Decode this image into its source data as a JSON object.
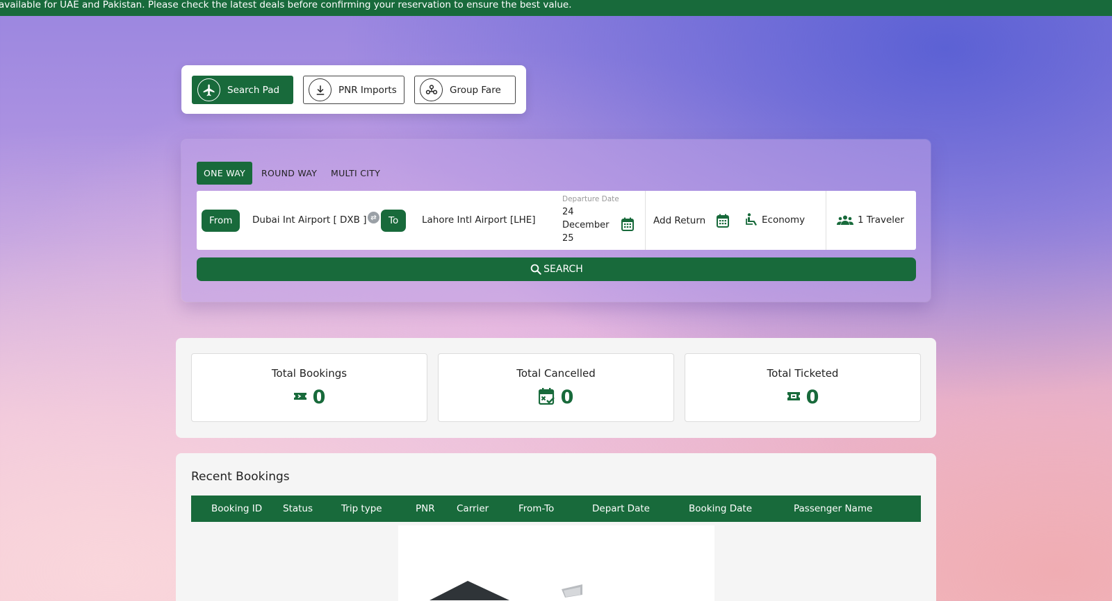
{
  "banner": {
    "text": "available for UAE and Pakistan. Please check the latest deals before confirming your reservation to ensure the best value."
  },
  "toolpad": {
    "buttons": [
      {
        "label": "Search Pad",
        "icon": "airplane-icon",
        "active": true
      },
      {
        "label": "PNR Imports",
        "icon": "download-icon",
        "active": false
      },
      {
        "label": "Group Fare",
        "icon": "group-icon",
        "active": false
      }
    ]
  },
  "search": {
    "trip_tabs": [
      "ONE WAY",
      "ROUND WAY",
      "MULTI CITY"
    ],
    "active_tab": "ONE WAY",
    "from_label": "From",
    "from_value": "Dubai Int Airport [ DXB ]",
    "to_label": "To",
    "to_value": "Lahore Intl Airport [LHE]",
    "departure_label": "Departure Date",
    "departure_value": "24 December 25",
    "add_return": "Add Return",
    "cabin_class": "Economy",
    "travelers": "1 Traveler",
    "search_button": "SEARCH"
  },
  "stats": [
    {
      "title": "Total Bookings",
      "value": "0",
      "icon": "ticket-icon"
    },
    {
      "title": "Total Cancelled",
      "value": "0",
      "icon": "calendar-cancel-icon"
    },
    {
      "title": "Total Ticketed",
      "value": "0",
      "icon": "ticket-icon"
    }
  ],
  "recent_bookings": {
    "title": "Recent Bookings",
    "columns": [
      "Booking ID",
      "Status",
      "Trip type",
      "PNR",
      "Carrier",
      "From-To",
      "Depart Date",
      "Booking Date",
      "Passenger Name"
    ],
    "rows": []
  },
  "colors": {
    "brand_green": "#186a3b"
  }
}
